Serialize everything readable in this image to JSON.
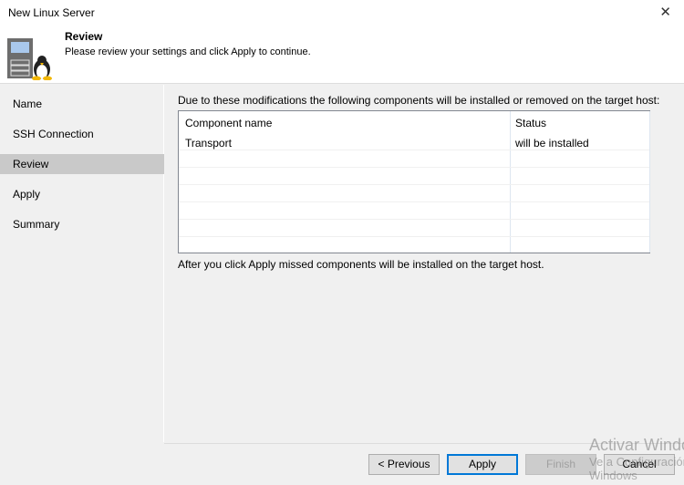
{
  "window": {
    "title": "New Linux Server"
  },
  "header": {
    "title": "Review",
    "subtitle": "Please review your settings and click Apply to continue."
  },
  "sidebar": {
    "items": [
      {
        "label": "Name"
      },
      {
        "label": "SSH Connection"
      },
      {
        "label": "Review",
        "selected": true
      },
      {
        "label": "Apply"
      },
      {
        "label": "Summary"
      }
    ]
  },
  "main": {
    "intro": "Due to these modifications the following components will be installed or removed on the target host:",
    "columns": [
      "Component name",
      "Status"
    ],
    "rows": [
      {
        "component": "Transport",
        "status": "will be installed"
      }
    ],
    "after": "After you click Apply missed components will be installed on the target host."
  },
  "buttons": {
    "previous": "< Previous",
    "apply": "Apply",
    "finish": "Finish",
    "cancel": "Cancel"
  },
  "watermark": {
    "line1": "Activar Windows",
    "line2": "Ve a Configuración para activar",
    "line3": "Windows"
  }
}
